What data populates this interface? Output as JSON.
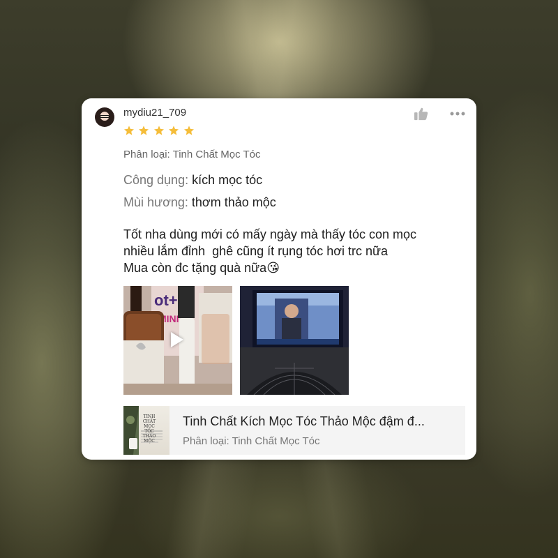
{
  "review": {
    "username": "mydiu21_709",
    "rating": 5,
    "variant": "Phân loại: Tinh Chất Mọc Tóc",
    "attributes": [
      {
        "key": "Công dụng:",
        "value": "kích mọc tóc"
      },
      {
        "key": "Mùi hương:",
        "value": "thơm thảo mộc"
      }
    ],
    "body_lines": [
      "Tốt nha dùng mới có mấy ngày mà thấy tóc con mọc",
      "nhiều lắm đỉnh  ghê cũng ít rụng tóc hơi trc nữa",
      "Mua còn đc tặng quà nữa😘"
    ]
  },
  "media": {
    "video_bottle_text": "ot+ex",
    "video_box_text": "MINI"
  },
  "product": {
    "title": "Tinh Chất Kích Mọc Tóc Thảo Mộc đậm đ...",
    "variant": "Phân loại: Tinh Chất Mọc Tóc",
    "thumb_title": "TINH CHẤT MỌC TÓC THẢO MỘC"
  },
  "colors": {
    "star": "#F5BD3A",
    "like_icon": "#B7B7B7"
  }
}
